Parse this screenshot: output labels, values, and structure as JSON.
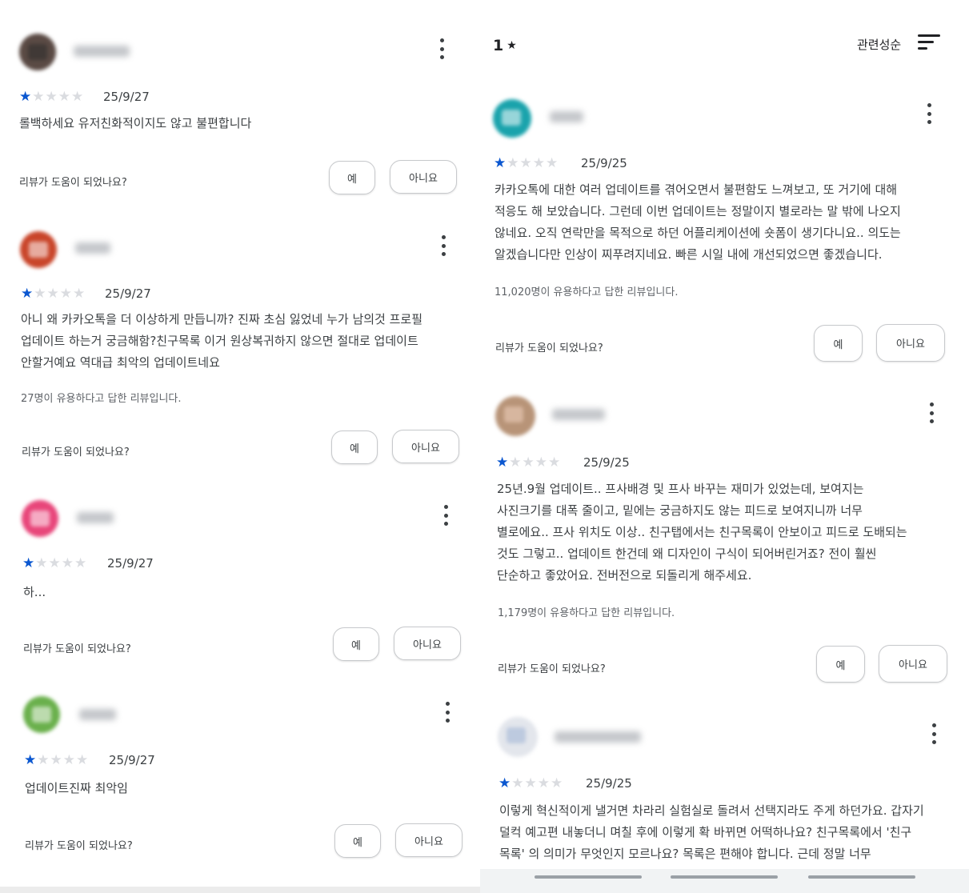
{
  "header": {
    "rating_filter_value": "1",
    "rating_filter_star": "★",
    "sort_label": "관련성순",
    "sort_icon": "sort-icon"
  },
  "common": {
    "star_filled": "★",
    "star_empty": "★",
    "helpful_question": "리뷰가 도움이 되었나요?",
    "yes_label": "예",
    "no_label": "아니요",
    "more_icon": "more-vert-icon",
    "accent_color": "#0b57d0"
  },
  "left_reviews": [
    {
      "rating": 1,
      "date": "25/9/27",
      "text": "롤백하세요 유저친화적이지도 않고 불편합니다",
      "helpful": ""
    },
    {
      "rating": 1,
      "date": "25/9/27",
      "text": "아니 왜 카카오톡을 더 이상하게 만듭니까? 진짜 초심 잃었네 누가 남의것 프로필\n업데이트 하는거 궁금해함?친구목록 이거 원상복귀하지 않으면 절대로 업데이트\n안할거예요 역대급 최악의 업데이트네요",
      "helpful": "27명이 유용하다고 답한 리뷰입니다."
    },
    {
      "rating": 1,
      "date": "25/9/27",
      "text": "하...",
      "helpful": ""
    },
    {
      "rating": 1,
      "date": "25/9/27",
      "text": "업데이트진짜 최악임",
      "helpful": ""
    }
  ],
  "right_reviews": [
    {
      "rating": 1,
      "date": "25/9/25",
      "text": "카카오톡에 대한 여러 업데이트를 겪어오면서 불편함도 느껴보고, 또 거기에 대해\n적응도 해 보았습니다. 그런데 이번 업데이트는 정말이지 별로라는 말 밖에 나오지\n않네요. 오직 연락만을 목적으로 하던 어플리케이션에 숏폼이 생기다니요.. 의도는\n알겠습니다만 인상이 찌푸려지네요. 빠른 시일 내에 개선되었으면 좋겠습니다.",
      "helpful": "11,020명이 유용하다고 답한 리뷰입니다."
    },
    {
      "rating": 1,
      "date": "25/9/25",
      "text": "25년.9월 업데이트.. 프사배경 및 프사 바꾸는 재미가 있었는데, 보여지는\n사진크기를 대폭 줄이고, 밑에는 궁금하지도 않는 피드로 보여지니까 너무\n별로에요.. 프사 위치도 이상.. 친구탭에서는 친구목록이 안보이고 피드로 도배되는\n것도 그렇고.. 업데이트 한건데 왜 디자인이 구식이 되어버린거죠? 전이 훨씬\n단순하고 좋았어요. 전버전으로 되돌리게 해주세요.",
      "helpful": "1,179명이 유용하다고 답한 리뷰입니다."
    },
    {
      "rating": 1,
      "date": "25/9/25",
      "text": "이렇게 혁신적이게 낼거면 차라리 실험실로 돌려서 선택지라도 주게 하던가요. 갑자기\n덜컥 예고편 내놓더니 며칠 후에 이렇게 확 바뀌면 어떡하나요? 친구목록에서 '친구\n목록' 의 의미가 무엇인지 모르나요? 목록은 편해야 합니다. 근데 정말 너무",
      "helpful": ""
    }
  ]
}
